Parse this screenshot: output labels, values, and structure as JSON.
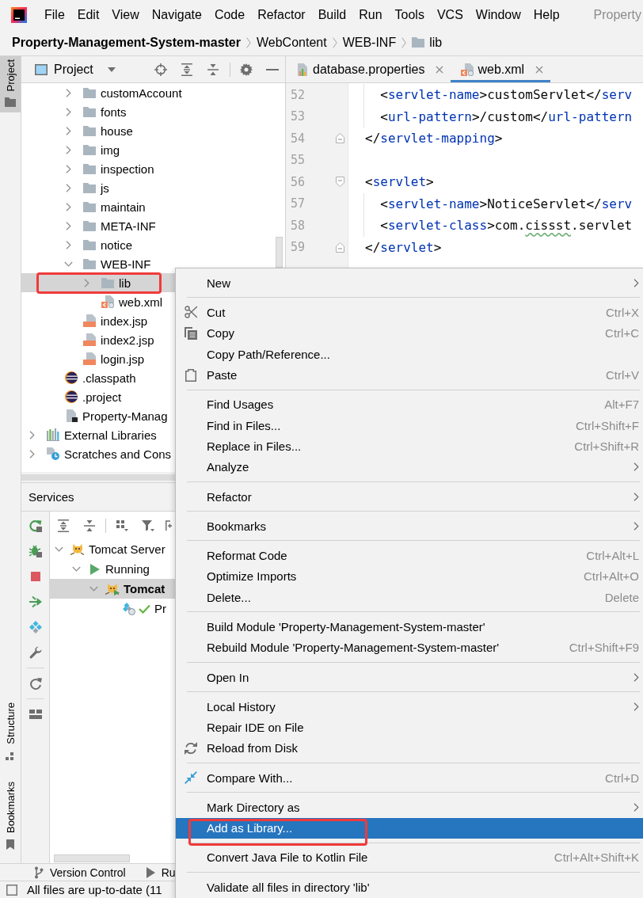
{
  "window": {
    "title": "Property"
  },
  "menu_bar": [
    "File",
    "Edit",
    "View",
    "Navigate",
    "Code",
    "Refactor",
    "Build",
    "Run",
    "Tools",
    "VCS",
    "Window",
    "Help"
  ],
  "breadcrumbs": [
    {
      "label": "Property-Management-System-master",
      "kind": "module"
    },
    {
      "label": "WebContent",
      "kind": "directory"
    },
    {
      "label": "WEB-INF",
      "kind": "directory"
    },
    {
      "label": "lib",
      "kind": "folder"
    }
  ],
  "tool_stripe": {
    "top": [
      {
        "label": "Project",
        "kind": "project",
        "selected": true
      }
    ],
    "bottom": [
      {
        "label": "Structure",
        "kind": "structure",
        "selected": false
      },
      {
        "label": "Bookmarks",
        "kind": "bookmarks",
        "selected": false
      }
    ]
  },
  "project_panel": {
    "title": "Project",
    "tree": [
      {
        "children": [
          {
            "children": [
              {
                "label": "customAccount",
                "kind": "folder",
                "expanded": false,
                "selected": false,
                "outlined": false
              },
              {
                "label": "fonts",
                "kind": "folder",
                "expanded": false,
                "selected": false,
                "outlined": false
              },
              {
                "label": "house",
                "kind": "folder",
                "expanded": false,
                "selected": false,
                "outlined": false
              },
              {
                "label": "img",
                "kind": "folder",
                "expanded": false,
                "selected": false,
                "outlined": false
              },
              {
                "label": "inspection",
                "kind": "folder",
                "expanded": false,
                "selected": false,
                "outlined": false
              },
              {
                "label": "js",
                "kind": "folder",
                "expanded": false,
                "selected": false,
                "outlined": false
              },
              {
                "label": "maintain",
                "kind": "folder",
                "expanded": false,
                "selected": false,
                "outlined": false
              },
              {
                "label": "META-INF",
                "kind": "folder",
                "expanded": false,
                "selected": false,
                "outlined": false
              },
              {
                "label": "notice",
                "kind": "folder",
                "expanded": false,
                "selected": false,
                "outlined": false
              },
              {
                "label": "WEB-INF",
                "kind": "folder",
                "expanded": true,
                "selected": false,
                "outlined": false,
                "children": [
                  {
                    "label": "lib",
                    "kind": "folder",
                    "expanded": false,
                    "selected": true,
                    "outlined": true
                  },
                  {
                    "label": "web.xml",
                    "kind": "xml",
                    "selected": false,
                    "outlined": false
                  }
                ]
              },
              {
                "label": "index.jsp",
                "kind": "jsp",
                "selected": false,
                "outlined": false
              },
              {
                "label": "index2.jsp",
                "kind": "jsp",
                "selected": false,
                "outlined": false
              },
              {
                "label": "login.jsp",
                "kind": "jsp",
                "selected": false,
                "outlined": false
              }
            ]
          },
          {
            "label": ".classpath",
            "kind": "eclipse",
            "selected": false,
            "outlined": false
          },
          {
            "label": ".project",
            "kind": "eclipse",
            "selected": false,
            "outlined": false
          },
          {
            "label": "Property-Manag",
            "kind": "module",
            "selected": false,
            "outlined": false
          }
        ]
      },
      {
        "label": "External Libraries",
        "kind": "libraries",
        "expanded": false,
        "selected": false,
        "outlined": false
      },
      {
        "label": "Scratches and Cons",
        "kind": "scratches",
        "expanded": false,
        "selected": false,
        "outlined": false
      }
    ]
  },
  "editor": {
    "tabs": [
      {
        "label": "database.properties",
        "kind": "properties",
        "selected": false
      },
      {
        "label": "web.xml",
        "kind": "xml",
        "selected": true
      }
    ],
    "lines": [
      {
        "number": "52",
        "kind": "plain",
        "indented": true,
        "tokens": [
          {
            "kind": "bracket",
            "text": "<"
          },
          {
            "kind": "tag",
            "text": "servlet-name"
          },
          {
            "kind": "bracket",
            "text": ">"
          },
          {
            "kind": "text",
            "text": "customServlet"
          },
          {
            "kind": "bracket",
            "text": "</"
          },
          {
            "kind": "tag",
            "text": "serv"
          }
        ]
      },
      {
        "number": "53",
        "kind": "plain",
        "indented": true,
        "tokens": [
          {
            "kind": "bracket",
            "text": "<"
          },
          {
            "kind": "tag",
            "text": "url-pattern"
          },
          {
            "kind": "bracket",
            "text": ">"
          },
          {
            "kind": "text",
            "text": "/custom"
          },
          {
            "kind": "bracket",
            "text": "</"
          },
          {
            "kind": "tag",
            "text": "url-pattern"
          }
        ]
      },
      {
        "number": "54",
        "kind": "close",
        "indented": false,
        "tokens": [
          {
            "kind": "bracket",
            "text": "</"
          },
          {
            "kind": "tag",
            "text": "servlet-mapping"
          },
          {
            "kind": "bracket",
            "text": ">"
          }
        ]
      },
      {
        "number": "55",
        "kind": "plain"
      },
      {
        "number": "56",
        "kind": "open",
        "indented": false,
        "tokens": [
          {
            "kind": "bracket",
            "text": "<"
          },
          {
            "kind": "tag",
            "text": "servlet"
          },
          {
            "kind": "bracket",
            "text": ">"
          }
        ]
      },
      {
        "number": "57",
        "kind": "plain",
        "indented": true,
        "tokens": [
          {
            "kind": "bracket",
            "text": "<"
          },
          {
            "kind": "tag",
            "text": "servlet-name"
          },
          {
            "kind": "bracket",
            "text": ">"
          },
          {
            "kind": "text",
            "text": "NoticeServlet"
          },
          {
            "kind": "bracket",
            "text": "</"
          },
          {
            "kind": "tag",
            "text": "serv"
          }
        ]
      },
      {
        "number": "58",
        "kind": "plain",
        "indented": true,
        "tokens": [
          {
            "kind": "bracket",
            "text": "<"
          },
          {
            "kind": "tag",
            "text": "servlet-class"
          },
          {
            "kind": "bracket",
            "text": ">"
          },
          {
            "kind": "text",
            "text": "com."
          },
          {
            "kind": "typo",
            "text": "cissst"
          },
          {
            "kind": "text",
            "text": ".servlet"
          }
        ]
      },
      {
        "number": "59",
        "kind": "close",
        "indented": false,
        "tokens": [
          {
            "kind": "bracket",
            "text": "</"
          },
          {
            "kind": "tag",
            "text": "servlet"
          },
          {
            "kind": "bracket",
            "text": ">"
          }
        ]
      }
    ]
  },
  "services": {
    "title": "Services",
    "tree": [
      {
        "label": "Tomcat Server",
        "kind": "server",
        "expanded": true,
        "selected": false,
        "children": [
          {
            "label": "Running",
            "kind": "status",
            "expanded": true,
            "selected": false,
            "children": [
              {
                "label": "Tomcat",
                "kind": "configuration",
                "expanded": true,
                "selected": true,
                "children": [
                  {
                    "label": "Pr",
                    "kind": "artifact",
                    "selected": false
                  }
                ]
              }
            ]
          }
        ]
      }
    ]
  },
  "bottom_bar": [
    {
      "label": "Version Control",
      "kind": "vcs"
    },
    {
      "label": "Ru",
      "kind": "run"
    }
  ],
  "status_bar": {
    "message": "All files are up-to-date (11"
  },
  "context_menu": {
    "groups": [
      [
        {
          "label": "New",
          "kind": "plain",
          "submenu": true,
          "selected": false,
          "outlined": false
        }
      ],
      [
        {
          "label": "Cut",
          "kind": "cut",
          "shortcut": "Ctrl+X",
          "submenu": false,
          "selected": false,
          "outlined": false
        },
        {
          "label": "Copy",
          "kind": "copy",
          "shortcut": "Ctrl+C",
          "submenu": false,
          "selected": false,
          "outlined": false
        },
        {
          "label": "Copy Path/Reference...",
          "kind": "plain",
          "submenu": false,
          "selected": false,
          "outlined": false
        },
        {
          "label": "Paste",
          "kind": "paste",
          "shortcut": "Ctrl+V",
          "submenu": false,
          "selected": false,
          "outlined": false
        }
      ],
      [
        {
          "label": "Find Usages",
          "kind": "plain",
          "shortcut": "Alt+F7",
          "submenu": false,
          "selected": false,
          "outlined": false
        },
        {
          "label": "Find in Files...",
          "kind": "plain",
          "shortcut": "Ctrl+Shift+F",
          "submenu": false,
          "selected": false,
          "outlined": false
        },
        {
          "label": "Replace in Files...",
          "kind": "plain",
          "shortcut": "Ctrl+Shift+R",
          "submenu": false,
          "selected": false,
          "outlined": false
        },
        {
          "label": "Analyze",
          "kind": "plain",
          "submenu": true,
          "selected": false,
          "outlined": false
        }
      ],
      [
        {
          "label": "Refactor",
          "kind": "plain",
          "submenu": true,
          "selected": false,
          "outlined": false
        }
      ],
      [
        {
          "label": "Bookmarks",
          "kind": "plain",
          "submenu": true,
          "selected": false,
          "outlined": false
        }
      ],
      [
        {
          "label": "Reformat Code",
          "kind": "plain",
          "shortcut": "Ctrl+Alt+L",
          "submenu": false,
          "selected": false,
          "outlined": false
        },
        {
          "label": "Optimize Imports",
          "kind": "plain",
          "shortcut": "Ctrl+Alt+O",
          "submenu": false,
          "selected": false,
          "outlined": false
        },
        {
          "label": "Delete...",
          "kind": "plain",
          "shortcut": "Delete",
          "submenu": false,
          "selected": false,
          "outlined": false
        }
      ],
      [
        {
          "label": "Build Module 'Property-Management-System-master'",
          "kind": "plain",
          "submenu": false,
          "selected": false,
          "outlined": false
        },
        {
          "label": "Rebuild Module 'Property-Management-System-master'",
          "kind": "plain",
          "shortcut": "Ctrl+Shift+F9",
          "submenu": false,
          "selected": false,
          "outlined": false
        }
      ],
      [
        {
          "label": "Open In",
          "kind": "plain",
          "submenu": true,
          "selected": false,
          "outlined": false
        }
      ],
      [
        {
          "label": "Local History",
          "kind": "plain",
          "submenu": true,
          "selected": false,
          "outlined": false
        },
        {
          "label": "Repair IDE on File",
          "kind": "plain",
          "submenu": false,
          "selected": false,
          "outlined": false
        },
        {
          "label": "Reload from Disk",
          "kind": "reload",
          "submenu": false,
          "selected": false,
          "outlined": false
        }
      ],
      [
        {
          "label": "Compare With...",
          "kind": "compare",
          "shortcut": "Ctrl+D",
          "submenu": false,
          "selected": false,
          "outlined": false
        }
      ],
      [
        {
          "label": "Mark Directory as",
          "kind": "plain",
          "submenu": true,
          "selected": false,
          "outlined": false
        },
        {
          "label": "Add as Library...",
          "kind": "plain",
          "submenu": false,
          "selected": true,
          "outlined": true
        }
      ],
      [
        {
          "label": "Convert Java File to Kotlin File",
          "kind": "plain",
          "shortcut": "Ctrl+Alt+Shift+K",
          "submenu": false,
          "selected": false,
          "outlined": false
        }
      ],
      [
        {
          "label": "Validate all files in directory 'lib'",
          "kind": "plain",
          "submenu": false,
          "selected": false,
          "outlined": false
        }
      ]
    ]
  }
}
